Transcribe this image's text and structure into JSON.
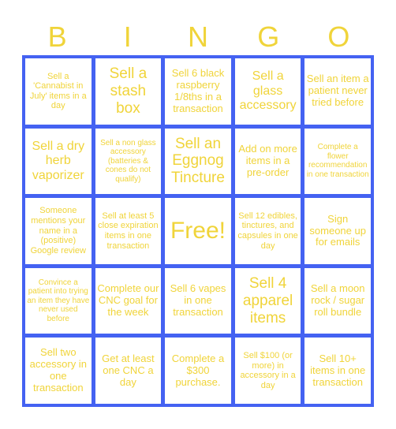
{
  "header": {
    "letters": [
      "B",
      "I",
      "N",
      "G",
      "O"
    ]
  },
  "colors": {
    "grid": "#4462f2",
    "text": "#f0d43a",
    "cell_bg": "#ffffff"
  },
  "cells": [
    [
      "Sell a 'Cannabist in July' items in a day",
      "Sell a stash box",
      "Sell 6 black raspberry 1/8ths in a transaction",
      "Sell a glass accessory",
      "Sell an item a patient never tried before"
    ],
    [
      "Sell a dry herb vaporizer",
      "Sell a non glass accessory (batteries & cones do not qualify)",
      "Sell an Eggnog Tincture",
      "Add on more items in a pre-order",
      "Complete a flower recommendation in one transaction"
    ],
    [
      "Someone mentions your name in a (positive) Google review",
      "Sell at least 5 close expiration items in one transaction",
      "Free!",
      "Sell 12 edibles, tinctures, and capsules in one day",
      "Sign someone up for emails"
    ],
    [
      "Convince a patient into trying an item they have never used before",
      "Complete our CNC goal for the week",
      "Sell 6 vapes in one transaction",
      "Sell 4 apparel items",
      "Sell a moon rock / sugar roll bundle"
    ],
    [
      "Sell two accessory in one transaction",
      "Get at least one CNC a day",
      "Complete a $300 purchase.",
      "Sell $100 (or more) in accessory in a day",
      "Sell 10+ items in one transaction"
    ]
  ]
}
